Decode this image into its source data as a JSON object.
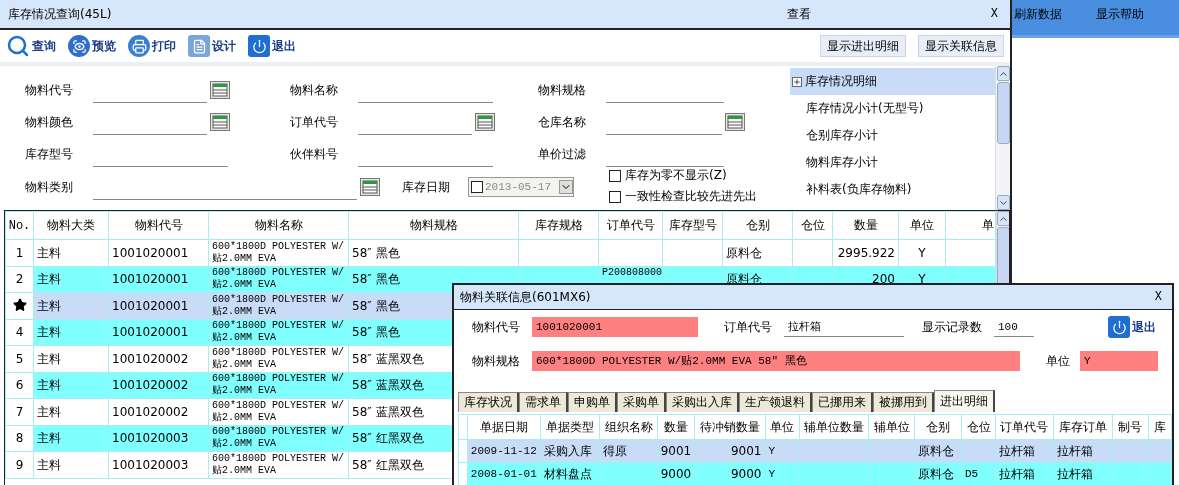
{
  "window": {
    "title": "库存情况查询(45L)",
    "center_title": "查看",
    "close": "X"
  },
  "side_menu": [
    "刷新数据",
    "显示帮助"
  ],
  "toolbar": [
    {
      "kind": "search",
      "label": "查询"
    },
    {
      "kind": "preview",
      "label": "预览"
    },
    {
      "kind": "print",
      "label": "打印"
    },
    {
      "kind": "design",
      "label": "设计"
    },
    {
      "kind": "exit",
      "label": "退出"
    }
  ],
  "buttons": [
    "显示进出明细",
    "显示关联信息"
  ],
  "filters": [
    {
      "label": "物料代号",
      "kind": "lookup"
    },
    {
      "label": "物料名称",
      "kind": "text"
    },
    {
      "label": "物料规格",
      "kind": "text"
    },
    {
      "label": "物料颜色",
      "kind": "lookup"
    },
    {
      "label": "订单代号",
      "kind": "lookup"
    },
    {
      "label": "仓库名称",
      "kind": "lookup"
    },
    {
      "label": "库存型号",
      "kind": "text"
    },
    {
      "label": "伙伴料号",
      "kind": "text"
    },
    {
      "label": "单价过滤",
      "kind": "text"
    }
  ],
  "category_filter": {
    "label": "物料类别"
  },
  "date_filter": {
    "label": "库存日期",
    "value": "2013-05-17",
    "checked": false
  },
  "options": [
    {
      "label": "库存为零不显示(Z)",
      "checked": false
    },
    {
      "label": "一致性检查比较先进先出",
      "checked": false
    }
  ],
  "report_list": [
    {
      "label": "库存情况明细",
      "selected": true,
      "expandable": true
    },
    {
      "label": "库存情况小计(无型号)",
      "selected": false,
      "expandable": false
    },
    {
      "label": "仓别库存小计",
      "selected": false,
      "expandable": false
    },
    {
      "label": "物料库存小计",
      "selected": false,
      "expandable": false
    },
    {
      "label": "补料表(负库存物料)",
      "selected": false,
      "expandable": false
    }
  ],
  "table": {
    "columns": [
      "No.",
      "物料大类",
      "物料代号",
      "物料名称",
      "物料规格",
      "库存规格",
      "订单代号",
      "库存型号",
      "仓别",
      "仓位",
      "数量",
      "单位",
      "单"
    ],
    "rows": [
      {
        "selected": false,
        "cells": [
          "1",
          "主料",
          "1001020001",
          "600*1800D POLYESTER W/贴2.0MM EVA",
          "58″ 黑色",
          "",
          "",
          "",
          "原料仓",
          "",
          "2995.922",
          "Y",
          ""
        ]
      },
      {
        "selected": false,
        "cells": [
          "2",
          "主料",
          "1001020001",
          "600*1800D POLYESTER W/贴2.0MM EVA",
          "58″ 黑色",
          "",
          "P200808000",
          "",
          "原料仓",
          "",
          "200",
          "Y",
          ""
        ]
      },
      {
        "selected": true,
        "cells": [
          "",
          "主料",
          "1001020001",
          "600*1800D POLYESTER W/贴2.0MM EVA",
          "58″ 黑色"
        ]
      },
      {
        "selected": false,
        "cells": [
          "4",
          "主料",
          "1001020001",
          "600*1800D POLYESTER W/贴2.0MM EVA",
          "58″ 黑色"
        ]
      },
      {
        "selected": false,
        "cells": [
          "5",
          "主料",
          "1001020002",
          "600*1800D POLYESTER W/贴2.0MM EVA",
          "58″ 蓝黑双色"
        ]
      },
      {
        "selected": false,
        "cells": [
          "6",
          "主料",
          "1001020002",
          "600*1800D POLYESTER W/贴2.0MM EVA",
          "58″ 蓝黑双色"
        ]
      },
      {
        "selected": false,
        "cells": [
          "7",
          "主料",
          "1001020002",
          "600*1800D POLYESTER W/贴2.0MM EVA",
          "58″ 蓝黑双色"
        ]
      },
      {
        "selected": false,
        "cells": [
          "8",
          "主料",
          "1001020003",
          "600*1800D POLYESTER W/贴2.0MM EVA",
          "58″ 红黑双色"
        ]
      },
      {
        "selected": false,
        "cells": [
          "9",
          "主料",
          "1001020003",
          "600*1800D POLYESTER W/贴2.0MM EVA",
          "58″ 红黑双色"
        ]
      }
    ]
  },
  "dialog": {
    "title": "物料关联信息(601MX6)",
    "close": "X",
    "field_rows": [
      [
        {
          "label": "物料代号",
          "value": "1001020001",
          "kind": "highlight"
        },
        {
          "label": "订单代号",
          "value": "拉杆箱",
          "kind": "plain"
        },
        {
          "label": "显示记录数",
          "value": "100",
          "kind": "plain"
        }
      ],
      [
        {
          "label": "物料规格",
          "value": "600*1800D POLYESTER W/贴2.0MM EVA 58″ 黑色",
          "kind": "highlight"
        },
        {
          "label": "单位",
          "value": "Y",
          "kind": "highlight"
        }
      ]
    ],
    "exit_button": "退出",
    "tabs": [
      {
        "label": "库存状况",
        "selected": false
      },
      {
        "label": "需求单",
        "selected": false
      },
      {
        "label": "申购单",
        "selected": false
      },
      {
        "label": "采购单",
        "selected": false
      },
      {
        "label": "采购出入库",
        "selected": false
      },
      {
        "label": "生产领退料",
        "selected": false
      },
      {
        "label": "已挪用来",
        "selected": false
      },
      {
        "label": "被挪用到",
        "selected": false
      },
      {
        "label": "进出明细",
        "selected": true
      }
    ],
    "grid": {
      "columns": [
        "单据日期",
        "单据类型",
        "组织名称",
        "数量",
        "待冲销数量",
        "单位",
        "辅单位数量",
        "辅单位",
        "仓别",
        "仓位",
        "订单代号",
        "库存订单",
        "制号",
        "库"
      ],
      "rows": [
        {
          "selected": true,
          "cells": [
            "2009-11-12",
            "采购入库",
            "得原",
            "9001",
            "9001",
            "Y",
            "",
            "",
            "原料仓",
            "",
            "拉杆箱",
            "拉杆箱",
            "",
            ""
          ]
        },
        {
          "selected": false,
          "cells": [
            "2008-01-01",
            "材料盘点",
            "",
            "9000",
            "9000",
            "Y",
            "",
            "",
            "原料仓",
            "D5",
            "拉杆箱",
            "拉杆箱",
            "",
            ""
          ]
        }
      ]
    }
  }
}
